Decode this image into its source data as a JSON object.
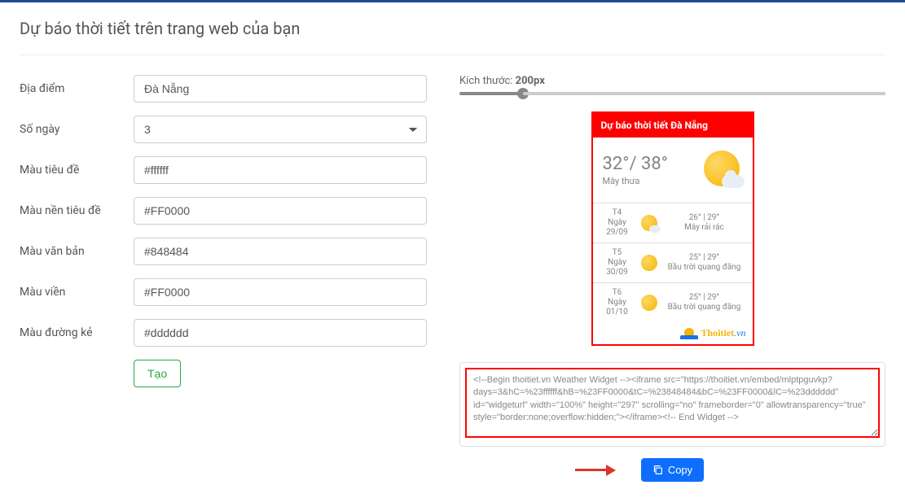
{
  "pageTitle": "Dự báo thời tiết trên trang web của bạn",
  "form": {
    "locationLabel": "Địa điểm",
    "locationValue": "Đà Nẵng",
    "daysLabel": "Số ngày",
    "daysValue": "3",
    "titleColorLabel": "Màu tiêu đề",
    "titleColorValue": "#ffffff",
    "titleBgLabel": "Màu nền tiêu đề",
    "titleBgValue": "#FF0000",
    "textColorLabel": "Màu văn bản",
    "textColorValue": "#848484",
    "borderColorLabel": "Màu viền",
    "borderColorValue": "#FF0000",
    "lineColorLabel": "Màu đường kẻ",
    "lineColorValue": "#dddddd",
    "createBtn": "Tạo"
  },
  "sizeLabel": "Kích thước: ",
  "sizeValue": "200px",
  "widget": {
    "header": "Dự báo thời tiết Đà Nẵng",
    "currentTemp": "32°/ 38°",
    "currentDesc": "Mây thưa",
    "days": [
      {
        "dow": "T4",
        "dayWord": "Ngày",
        "date": "29/09",
        "temp": "26° | 29°",
        "desc": "Mây rải rác",
        "cloudy": true
      },
      {
        "dow": "T5",
        "dayWord": "Ngày",
        "date": "30/09",
        "temp": "25° | 29°",
        "desc": "Bầu trời quang đãng",
        "cloudy": false
      },
      {
        "dow": "T6",
        "dayWord": "Ngày",
        "date": "01/10",
        "temp": "25° | 29°",
        "desc": "Bầu trời quang đãng",
        "cloudy": false
      }
    ],
    "brand": "Thoitiet",
    "brandSuffix": ".vn"
  },
  "embedCode": "<!--Begin thoitiet.vn Weather Widget --><iframe src=\"https://thoitiet.vn/embed/mlptpguvkp?days=3&hC=%23ffffff&hB=%23FF0000&tC=%23848484&bC=%23FF0000&lC=%23dddddd\" id=\"widgeturl\" width=\"100%\" height=\"297\" scrolling=\"no\" frameborder=\"0\" allowtransparency=\"true\" style=\"border:none;overflow:hidden;\"></iframe><!-- End Widget -->",
  "copyBtn": "Copy"
}
